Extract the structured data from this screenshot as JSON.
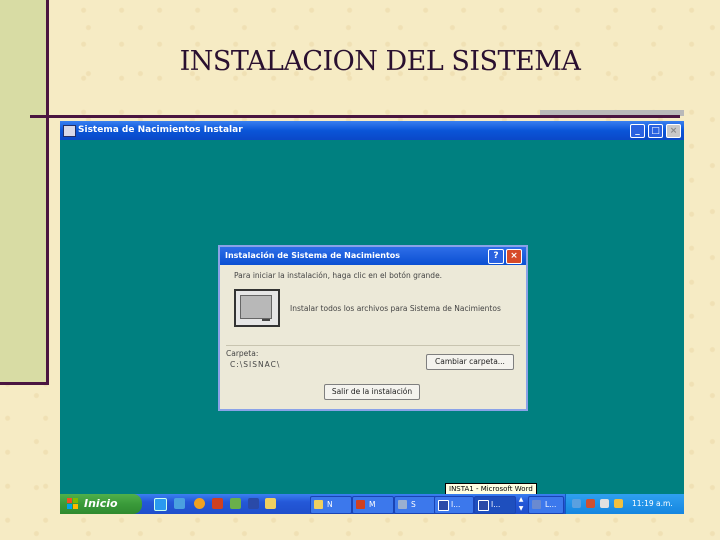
{
  "slide": {
    "title": "INSTALACION DEL SISTEMA"
  },
  "window": {
    "title": "Sistema de Nacimientos Instalar",
    "controls": {
      "minimize": "_",
      "maximize": "□",
      "close": "×"
    }
  },
  "dialog": {
    "title": "Instalación de Sistema de Nacimientos",
    "help_label": "?",
    "close_label": "×",
    "message": "Para iniciar la instalación, haga clic en el botón grande.",
    "install_text": "Instalar todos los archivos para Sistema de Nacimientos",
    "folder_label": "Carpeta:",
    "folder_path": "C:\\SISNAC\\",
    "change_folder_label": "Cambiar carpeta...",
    "exit_label": "Salir de la instalación"
  },
  "tooltip": "INSTA1 - Microsoft Word",
  "taskbar": {
    "start_label": "Inicio",
    "tasks": [
      {
        "label": "N",
        "icon": "folder-icon"
      },
      {
        "label": "M",
        "icon": "media-icon"
      },
      {
        "label": "S",
        "icon": "setup-icon"
      },
      {
        "label": "I...",
        "icon": "word-icon"
      },
      {
        "label": "I...",
        "icon": "word-icon"
      },
      {
        "label": "L...",
        "icon": "window-icon"
      }
    ],
    "clock": "11:19 a.m."
  },
  "colors": {
    "desktop": "#008080",
    "titlebar": "#0a55d8",
    "start_button": "#3a9a3a",
    "slide_background": "#f6ebc4",
    "accent_rule": "#4a1540"
  }
}
